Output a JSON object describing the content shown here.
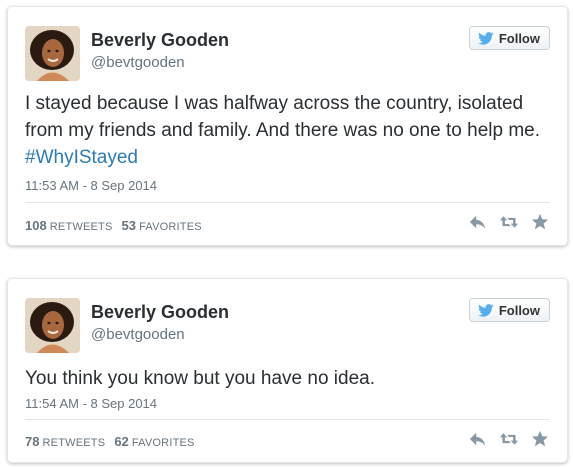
{
  "colors": {
    "link": "#2b7bb9",
    "name": "#292f33",
    "meta": "#66757f",
    "icon": "#8899a6",
    "twitter_blue": "#55acee"
  },
  "tweets": [
    {
      "author_name": "Beverly Gooden",
      "author_handle": "@bevtgooden",
      "follow_label": "Follow",
      "text_before": "I stayed because I was halfway across the country, isolated from my friends and family. And there was no one to help me. ",
      "hashtag": "#WhyIStayed",
      "timestamp": "11:53 AM - 8 Sep 2014",
      "retweets_count": "108",
      "retweets_label": "RETWEETS",
      "favorites_count": "53",
      "favorites_label": "FAVORITES",
      "icons": [
        "reply-icon",
        "retweet-icon",
        "favorite-icon"
      ]
    },
    {
      "author_name": "Beverly Gooden",
      "author_handle": "@bevtgooden",
      "follow_label": "Follow",
      "text_before": "You think you know but you have no idea.",
      "hashtag": "",
      "timestamp": "11:54 AM - 8 Sep 2014",
      "retweets_count": "78",
      "retweets_label": "RETWEETS",
      "favorites_count": "62",
      "favorites_label": "FAVORITES",
      "icons": [
        "reply-icon",
        "retweet-icon",
        "favorite-icon"
      ]
    }
  ]
}
